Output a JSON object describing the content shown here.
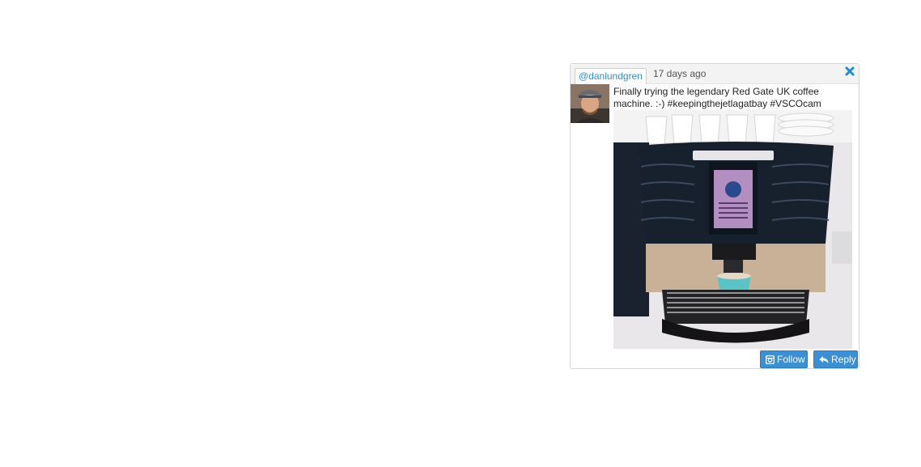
{
  "tweet": {
    "username": "@danlundgren",
    "time": "17 days ago",
    "text": "Finally trying the legendary Red Gate UK coffee machine. :-) #keepingthejetlagatbay #VSCOcam",
    "close_icon": "close-icon",
    "photo_alt": "coffee machine photo"
  },
  "actions": {
    "follow_label": "Follow",
    "follow_icon": "instagram-icon",
    "reply_label": "Reply",
    "reply_icon": "reply-icon"
  },
  "colors": {
    "accent": "#3b8fd4",
    "link": "#2f8fd0",
    "close": "#1a8fd6"
  }
}
